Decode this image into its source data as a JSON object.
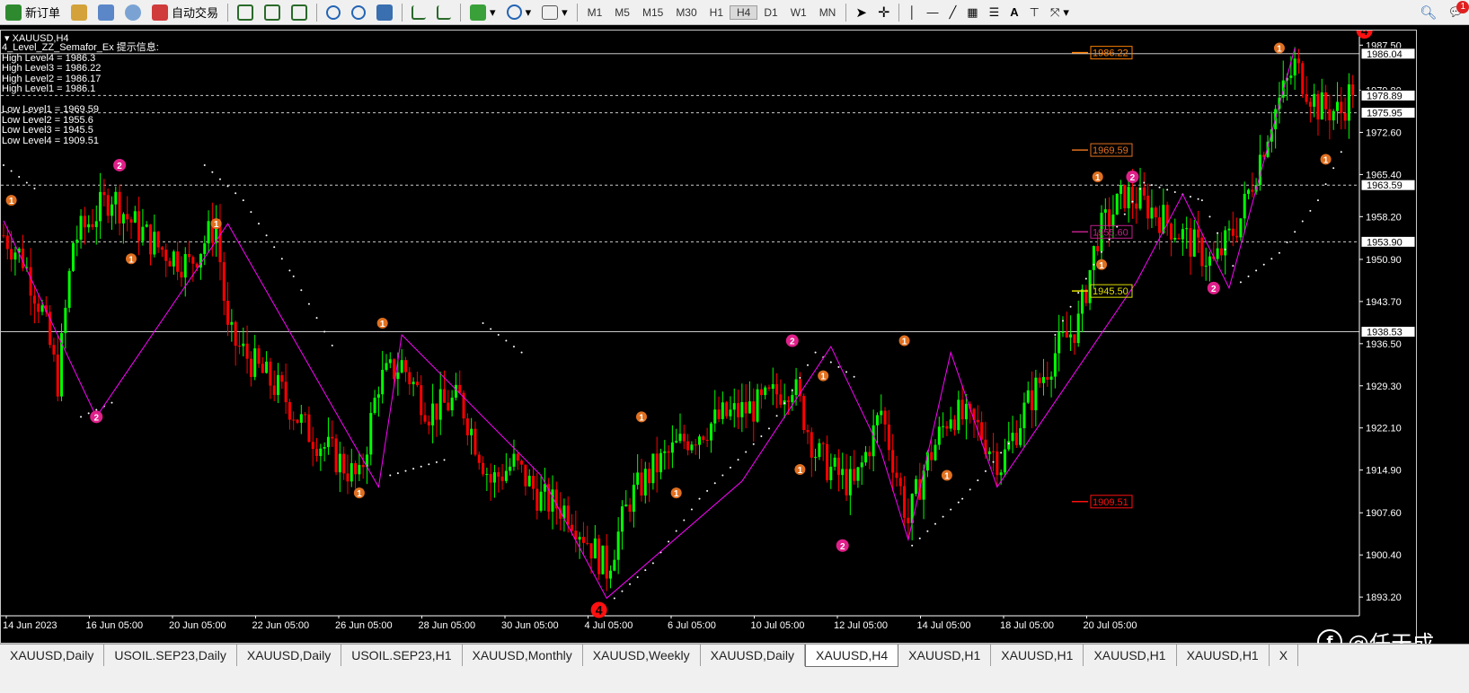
{
  "toolbar": {
    "new_order": "新订单",
    "auto_trade": "自动交易",
    "timeframes": [
      "M1",
      "M5",
      "M15",
      "M30",
      "H1",
      "H4",
      "D1",
      "W1",
      "MN"
    ],
    "active_timeframe": "H4"
  },
  "chart": {
    "symbol_title": "XAUUSD,H4",
    "indicator_title": "4_Level_ZZ_Semafor_Ex 提示信息:",
    "high_levels": [
      "High Level4 = 1986.3",
      "High Level3 = 1986.22",
      "High Level2 = 1986.17",
      "High Level1 = 1986.1"
    ],
    "low_levels": [
      "Low Level1 = 1969.59",
      "Low Level2 = 1955.6",
      "Low Level3 = 1945.5",
      "Low Level4 = 1909.51"
    ],
    "colors": {
      "bull": "#00ff00",
      "bear": "#ff0000",
      "zigzag": "#ff00ff",
      "sar": "#ffffff",
      "sema1": "#e07020",
      "sema2": "#e0208a",
      "sema4": "#ff1010",
      "grid": "#ffffff"
    }
  },
  "chart_data": {
    "type": "candlestick",
    "symbol": "XAUUSD",
    "timeframe": "H4",
    "ylim": [
      1890.0,
      1990.0
    ],
    "y_ticks": [
      "1987.50",
      "1979.80",
      "1972.60",
      "1965.40",
      "1958.20",
      "1950.90",
      "1943.70",
      "1936.50",
      "1929.30",
      "1922.10",
      "1914.90",
      "1907.60",
      "1900.40",
      "1893.20"
    ],
    "x_labels": [
      "14 Jun 2023",
      "16 Jun 05:00",
      "20 Jun 05:00",
      "22 Jun 05:00",
      "26 Jun 05:00",
      "28 Jun 05:00",
      "30 Jun 05:00",
      "4 Jul 05:00",
      "6 Jul 05:00",
      "10 Jul 05:00",
      "12 Jul 05:00",
      "14 Jul 05:00",
      "18 Jul 05:00",
      "20 Jul 05:00"
    ],
    "price_tags": [
      {
        "label": "1986.04",
        "value": 1986.04,
        "type": "current"
      },
      {
        "label": "1978.89",
        "value": 1978.89,
        "type": "line"
      },
      {
        "label": "1975.95",
        "value": 1975.95,
        "type": "line"
      },
      {
        "label": "1963.59",
        "value": 1963.59,
        "type": "line"
      },
      {
        "label": "1953.90",
        "value": 1953.9,
        "type": "line"
      },
      {
        "label": "1938.53",
        "value": 1938.53,
        "type": "line"
      }
    ],
    "level_labels": [
      {
        "label": "1986.22",
        "value": 1986.22,
        "color": "#ff8000"
      },
      {
        "label": "1969.59",
        "value": 1969.59,
        "color": "#e07020"
      },
      {
        "label": "1955.60",
        "value": 1955.6,
        "color": "#c0208a"
      },
      {
        "label": "1945.50",
        "value": 1945.5,
        "color": "#e0e000"
      },
      {
        "label": "1909.51",
        "value": 1909.51,
        "color": "#ff1010"
      }
    ],
    "horizontal_lines": [
      {
        "value": 1986.04,
        "style": "solid"
      },
      {
        "value": 1978.89,
        "style": "dashed"
      },
      {
        "value": 1975.95,
        "style": "dashed"
      },
      {
        "value": 1963.59,
        "style": "dashed"
      },
      {
        "value": 1953.9,
        "style": "dashed"
      },
      {
        "value": 1938.53,
        "style": "solid"
      }
    ],
    "zigzag": [
      [
        0,
        1957.5
      ],
      [
        24,
        1924
      ],
      [
        58,
        1957
      ],
      [
        97,
        1912
      ],
      [
        103,
        1938
      ],
      [
        139,
        1914
      ],
      [
        156,
        1893
      ],
      [
        191,
        1913
      ],
      [
        214,
        1936
      ],
      [
        227,
        1918
      ],
      [
        234,
        1903
      ],
      [
        245,
        1935
      ],
      [
        257,
        1912
      ],
      [
        293,
        1947
      ],
      [
        305,
        1962
      ],
      [
        317,
        1946
      ],
      [
        334,
        1987
      ]
    ],
    "semafors": [
      [
        2,
        1961,
        "1"
      ],
      [
        24,
        1924,
        "2"
      ],
      [
        30,
        1967,
        "2"
      ],
      [
        33,
        1951,
        "1"
      ],
      [
        55,
        1957,
        "1"
      ],
      [
        92,
        1911,
        "1"
      ],
      [
        98,
        1940,
        "1"
      ],
      [
        154,
        1891,
        "4"
      ],
      [
        165,
        1924,
        "1"
      ],
      [
        174,
        1911,
        "1"
      ],
      [
        204,
        1937,
        "2"
      ],
      [
        206,
        1915,
        "1"
      ],
      [
        212,
        1931,
        "1"
      ],
      [
        217,
        1902,
        "2"
      ],
      [
        233,
        1937,
        "1"
      ],
      [
        244,
        1914,
        "1"
      ],
      [
        283,
        1965,
        "1"
      ],
      [
        284,
        1950,
        "1"
      ],
      [
        292,
        1965,
        "2"
      ],
      [
        313,
        1946,
        "2"
      ],
      [
        330,
        1987,
        "1"
      ],
      [
        342,
        1968,
        "1"
      ],
      [
        352,
        1990,
        "4"
      ]
    ],
    "sar": [
      [
        0,
        1967
      ],
      [
        10,
        1962
      ],
      [
        20,
        1924
      ],
      [
        30,
        1927
      ],
      [
        42,
        1943
      ],
      [
        52,
        1967
      ],
      [
        62,
        1961
      ],
      [
        75,
        1948
      ],
      [
        86,
        1935
      ],
      [
        100,
        1914
      ],
      [
        116,
        1917
      ],
      [
        124,
        1940
      ],
      [
        136,
        1934
      ],
      [
        148,
        1916
      ],
      [
        158,
        1893
      ],
      [
        168,
        1899
      ],
      [
        180,
        1910
      ],
      [
        198,
        1922
      ],
      [
        210,
        1935
      ],
      [
        222,
        1930
      ],
      [
        235,
        1902
      ],
      [
        248,
        1910
      ],
      [
        262,
        1921
      ],
      [
        272,
        1938
      ],
      [
        282,
        1950
      ],
      [
        295,
        1964
      ],
      [
        310,
        1961
      ],
      [
        320,
        1947
      ],
      [
        330,
        1952
      ],
      [
        340,
        1961
      ],
      [
        348,
        1972
      ]
    ],
    "candles": {
      "count": 350,
      "start_price": 1955.0,
      "anchors": [
        [
          0,
          1955
        ],
        [
          5,
          1951
        ],
        [
          10,
          1942
        ],
        [
          14,
          1930
        ],
        [
          18,
          1954
        ],
        [
          28,
          1962
        ],
        [
          32,
          1958
        ],
        [
          40,
          1953
        ],
        [
          48,
          1950
        ],
        [
          55,
          1957
        ],
        [
          58,
          1938
        ],
        [
          66,
          1932
        ],
        [
          72,
          1928
        ],
        [
          78,
          1922
        ],
        [
          86,
          1917
        ],
        [
          92,
          1913
        ],
        [
          97,
          1930
        ],
        [
          103,
          1933
        ],
        [
          110,
          1925
        ],
        [
          118,
          1927
        ],
        [
          126,
          1913
        ],
        [
          132,
          1916
        ],
        [
          139,
          1910
        ],
        [
          146,
          1908
        ],
        [
          156,
          1898
        ],
        [
          162,
          1910
        ],
        [
          168,
          1915
        ],
        [
          176,
          1920
        ],
        [
          186,
          1924
        ],
        [
          196,
          1926
        ],
        [
          204,
          1930
        ],
        [
          210,
          1918
        ],
        [
          214,
          1915
        ],
        [
          220,
          1912
        ],
        [
          227,
          1925
        ],
        [
          234,
          1906
        ],
        [
          238,
          1915
        ],
        [
          245,
          1925
        ],
        [
          252,
          1922
        ],
        [
          258,
          1916
        ],
        [
          264,
          1925
        ],
        [
          272,
          1935
        ],
        [
          278,
          1940
        ],
        [
          283,
          1955
        ],
        [
          290,
          1962
        ],
        [
          296,
          1960
        ],
        [
          305,
          1955
        ],
        [
          313,
          1950
        ],
        [
          320,
          1958
        ],
        [
          328,
          1975
        ],
        [
          334,
          1984
        ],
        [
          340,
          1977
        ],
        [
          346,
          1976
        ],
        [
          352,
          1985
        ]
      ]
    }
  },
  "tabs": [
    "XAUUSD,Daily",
    "USOIL.SEP23,Daily",
    "XAUUSD,Daily",
    "USOIL.SEP23,H1",
    "XAUUSD,Monthly",
    "XAUUSD,Weekly",
    "XAUUSD,Daily",
    "XAUUSD,H4",
    "XAUUSD,H1",
    "XAUUSD,H1",
    "XAUUSD,H1",
    "XAUUSD,H1",
    "X"
  ],
  "active_tab": 7,
  "watermark": "@任天成",
  "notification_count": "1"
}
